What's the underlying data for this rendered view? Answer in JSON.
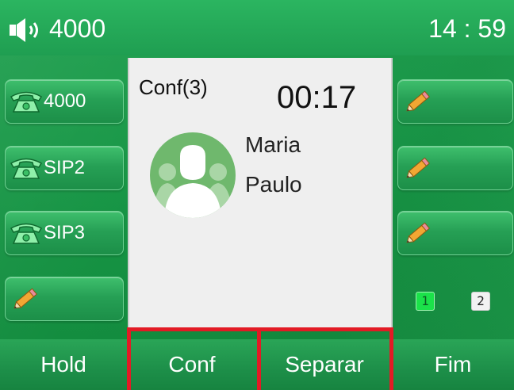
{
  "status_bar": {
    "account": "4000",
    "time": "14 : 59",
    "speaker_icon": "speaker-icon"
  },
  "left_line_keys": [
    {
      "label": "4000",
      "icon": "phone-icon"
    },
    {
      "label": "SIP2",
      "icon": "phone-icon"
    },
    {
      "label": "SIP3",
      "icon": "phone-icon"
    },
    {
      "label": "",
      "icon": "pencil-icon"
    }
  ],
  "right_line_keys": [
    {
      "label": "",
      "icon": "pencil-icon"
    },
    {
      "label": "",
      "icon": "pencil-icon"
    },
    {
      "label": "",
      "icon": "pencil-icon"
    }
  ],
  "pager": {
    "pages": [
      "1",
      "2"
    ],
    "active": "1"
  },
  "call": {
    "conference_label": "Conf(3)",
    "duration": "00:17",
    "participants": [
      "Maria",
      "Paulo"
    ],
    "avatar_icon": "group-avatar-icon"
  },
  "softkeys": {
    "hold": "Hold",
    "conf": "Conf",
    "separar": "Separar",
    "fim": "Fim"
  },
  "colors": {
    "background_green": "#169444",
    "highlight_red": "#e21b25",
    "panel_gray": "#efefef",
    "active_page": "#1be24a"
  }
}
